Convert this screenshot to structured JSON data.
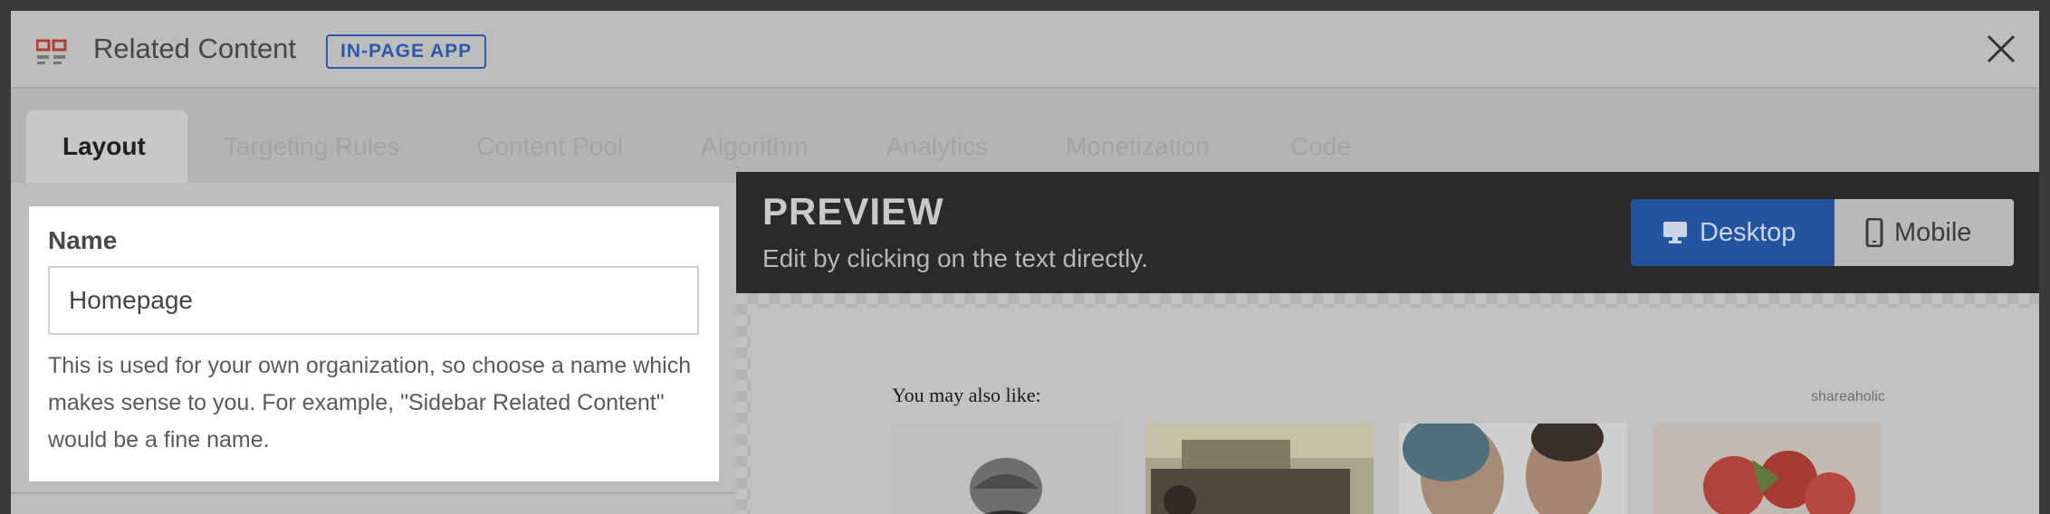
{
  "header": {
    "title": "Related Content",
    "badge": "IN-PAGE APP",
    "icon": "related-content-app-icon",
    "close_icon": "close-icon"
  },
  "tabs": [
    {
      "label": "Layout",
      "active": true
    },
    {
      "label": "Targeting Rules",
      "active": false
    },
    {
      "label": "Content Pool",
      "active": false
    },
    {
      "label": "Algorithm",
      "active": false
    },
    {
      "label": "Analytics",
      "active": false
    },
    {
      "label": "Monetization",
      "active": false
    },
    {
      "label": "Code",
      "active": false
    }
  ],
  "name_section": {
    "label": "Name",
    "value": "Homepage",
    "help": "This is used for your own organization, so choose a name which makes sense to you. For example, \"Sidebar Related Content\" would be a fine name."
  },
  "preview": {
    "title": "PREVIEW",
    "subtitle": "Edit by clicking on the text directly.",
    "desktop_label": "Desktop",
    "mobile_label": "Mobile",
    "selected": "Desktop"
  },
  "widget": {
    "heading": "You may also like:",
    "brand": "shareaholic",
    "thumbnails": [
      "person-in-knit-hat",
      "vintage-car",
      "smiling-couple",
      "strawberry-dish"
    ]
  },
  "colors": {
    "accent": "#2453a0",
    "badge": "#2c5aa8",
    "preview_bar": "#2a2a2a",
    "icon_red": "#c0392b"
  }
}
